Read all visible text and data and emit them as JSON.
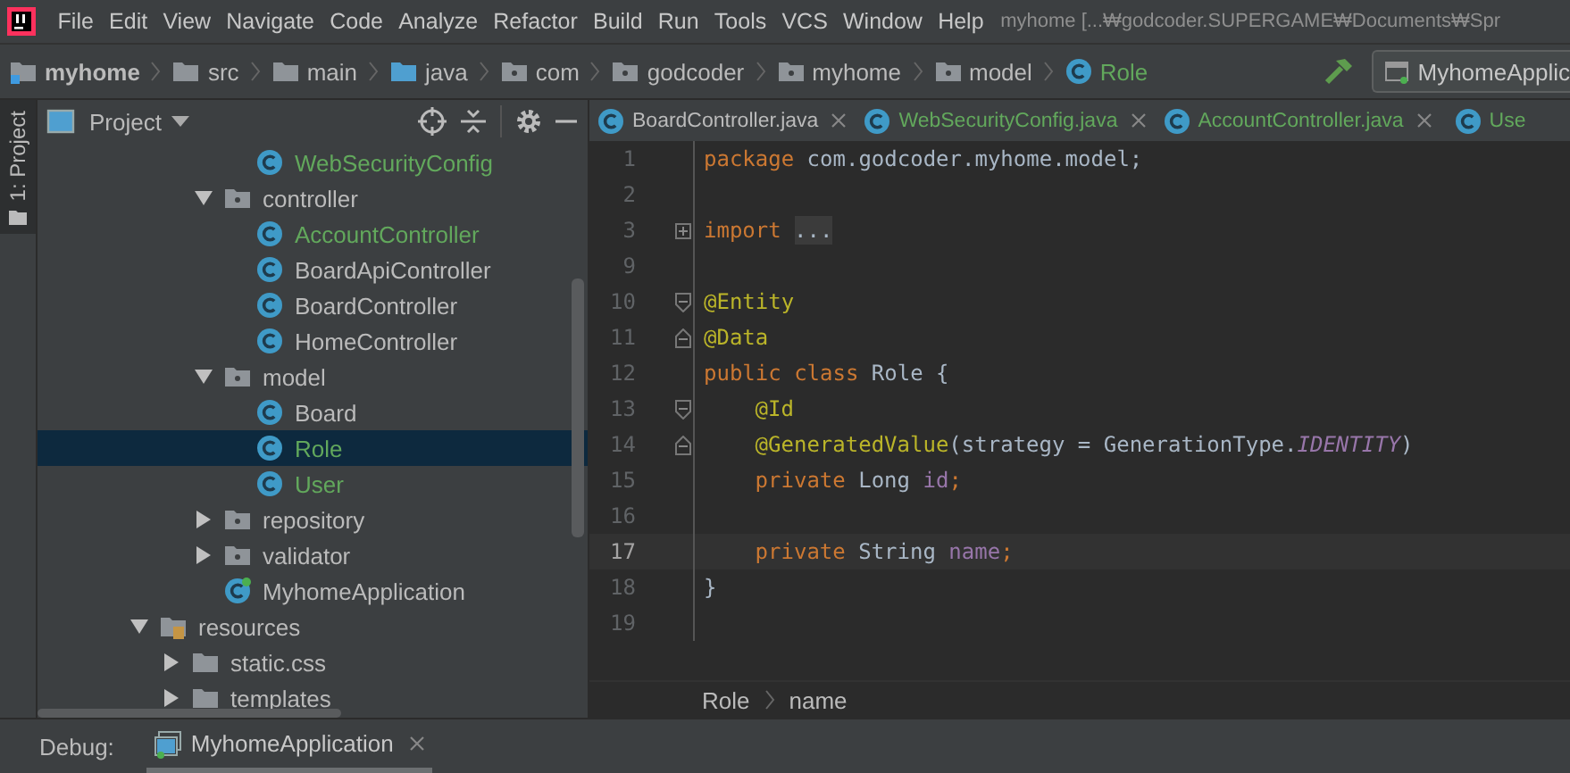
{
  "menu": [
    "File",
    "Edit",
    "View",
    "Navigate",
    "Code",
    "Analyze",
    "Refactor",
    "Build",
    "Run",
    "Tools",
    "VCS",
    "Window",
    "Help"
  ],
  "window_title": "myhome [...₩godcoder.SUPERGAME₩Documents₩Spr",
  "navigation": {
    "crumbs": [
      {
        "label": "myhome",
        "kind": "module",
        "added": false
      },
      {
        "label": "src",
        "kind": "folder",
        "added": false
      },
      {
        "label": "main",
        "kind": "folder",
        "added": false
      },
      {
        "label": "java",
        "kind": "source-folder",
        "added": false
      },
      {
        "label": "com",
        "kind": "package",
        "added": false
      },
      {
        "label": "godcoder",
        "kind": "package",
        "added": false
      },
      {
        "label": "myhome",
        "kind": "package",
        "added": false
      },
      {
        "label": "model",
        "kind": "package",
        "added": false
      },
      {
        "label": "Role",
        "kind": "class",
        "added": true
      }
    ],
    "run_config": "MyhomeApplic"
  },
  "tool_stripe": [
    {
      "label": "1: Project",
      "selected": true
    }
  ],
  "project_panel": {
    "title": "Project",
    "tree": [
      {
        "children": [
          {
            "children": [
              {
                "children": [
                  {
                    "label": "WebSecurityConfig",
                    "kind": "class",
                    "added": true,
                    "selected": false
                  }
                ]
              },
              {
                "label": "controller",
                "kind": "package",
                "expanded": true,
                "selected": false,
                "added": false,
                "children": [
                  {
                    "label": "AccountController",
                    "kind": "class",
                    "added": true,
                    "selected": false
                  },
                  {
                    "label": "BoardApiController",
                    "kind": "class",
                    "added": false,
                    "selected": false
                  },
                  {
                    "label": "BoardController",
                    "kind": "class",
                    "added": false,
                    "selected": false
                  },
                  {
                    "label": "HomeController",
                    "kind": "class",
                    "added": false,
                    "selected": false
                  }
                ]
              },
              {
                "label": "model",
                "kind": "package",
                "expanded": true,
                "selected": false,
                "added": false,
                "children": [
                  {
                    "label": "Board",
                    "kind": "class",
                    "added": false,
                    "selected": false
                  },
                  {
                    "label": "Role",
                    "kind": "class",
                    "added": true,
                    "selected": true
                  },
                  {
                    "label": "User",
                    "kind": "class",
                    "added": true,
                    "selected": false
                  }
                ]
              },
              {
                "label": "repository",
                "kind": "package",
                "expanded": false,
                "selected": false,
                "added": false
              },
              {
                "label": "validator",
                "kind": "package",
                "expanded": false,
                "selected": false,
                "added": false
              },
              {
                "label": "MyhomeApplication",
                "kind": "app-class",
                "added": false,
                "selected": false
              }
            ]
          }
        ]
      },
      {
        "label": "resources",
        "kind": "resources",
        "expanded": true,
        "selected": false,
        "added": false,
        "children": [
          {
            "label": "static.css",
            "kind": "folder",
            "expanded": false,
            "selected": false,
            "added": false
          },
          {
            "label": "templates",
            "kind": "folder",
            "expanded": false,
            "selected": false,
            "added": false
          }
        ]
      }
    ]
  },
  "editor": {
    "tabs": [
      {
        "label": "BoardController.java",
        "added": false,
        "selected": false,
        "closable": true
      },
      {
        "label": "WebSecurityConfig.java",
        "added": true,
        "selected": false,
        "closable": true
      },
      {
        "label": "AccountController.java",
        "added": true,
        "selected": false,
        "closable": true
      },
      {
        "label": "Use",
        "added": true,
        "selected": false,
        "closable": false
      }
    ],
    "lines": [
      {
        "number": "1",
        "current": false,
        "tokens": [
          {
            "kind": "keyword",
            "text": "package"
          },
          {
            "kind": "plain",
            "text": " com.godcoder.myhome.model;"
          }
        ]
      },
      {
        "number": "2",
        "current": false
      },
      {
        "number": "3",
        "current": false,
        "fold_marker": {
          "kind": "expand"
        },
        "tokens": [
          {
            "kind": "keyword",
            "text": "import"
          },
          {
            "kind": "folded",
            "text": "..."
          }
        ]
      },
      {
        "number": "9",
        "current": false
      },
      {
        "number": "10",
        "current": false,
        "fold_marker": {
          "kind": "start"
        },
        "tokens": [
          {
            "kind": "annotation",
            "text": "@Entity"
          }
        ]
      },
      {
        "number": "11",
        "current": false,
        "fold_marker": {
          "kind": "end"
        },
        "tokens": [
          {
            "kind": "annotation",
            "text": "@Data"
          }
        ]
      },
      {
        "number": "12",
        "current": false,
        "tokens": [
          {
            "kind": "keyword",
            "text": "public class"
          },
          {
            "kind": "plain",
            "text": " Role {"
          }
        ]
      },
      {
        "number": "13",
        "current": false,
        "fold_marker": {
          "kind": "start"
        },
        "indented": true,
        "tokens": [
          {
            "kind": "annotation",
            "text": "@Id"
          }
        ]
      },
      {
        "number": "14",
        "current": false,
        "fold_marker": {
          "kind": "end"
        },
        "indented": true,
        "tokens": [
          {
            "kind": "annotation",
            "text": "@GeneratedValue"
          },
          {
            "kind": "plain",
            "text": "(strategy = GenerationType."
          },
          {
            "kind": "constant",
            "text": "IDENTITY"
          },
          {
            "kind": "plain",
            "text": ")"
          }
        ]
      },
      {
        "number": "15",
        "current": false,
        "indented": true,
        "tokens": [
          {
            "kind": "keyword",
            "text": "private"
          },
          {
            "kind": "plain",
            "text": " Long "
          },
          {
            "kind": "field",
            "text": "id"
          },
          {
            "kind": "keyword",
            "text": ";"
          }
        ]
      },
      {
        "number": "16",
        "current": false
      },
      {
        "number": "17",
        "current": true,
        "indented": true,
        "tokens": [
          {
            "kind": "keyword",
            "text": "private"
          },
          {
            "kind": "plain",
            "text": " String "
          },
          {
            "kind": "field",
            "text": "name"
          },
          {
            "kind": "keyword",
            "text": ";"
          }
        ]
      },
      {
        "number": "18",
        "current": false,
        "tokens": [
          {
            "kind": "plain",
            "text": "}"
          }
        ]
      },
      {
        "number": "19",
        "current": false
      }
    ],
    "breadcrumb": [
      "Role",
      "name"
    ]
  },
  "debug": {
    "label": "Debug:",
    "tabs": [
      {
        "label": "MyhomeApplication",
        "selected": true
      }
    ]
  }
}
